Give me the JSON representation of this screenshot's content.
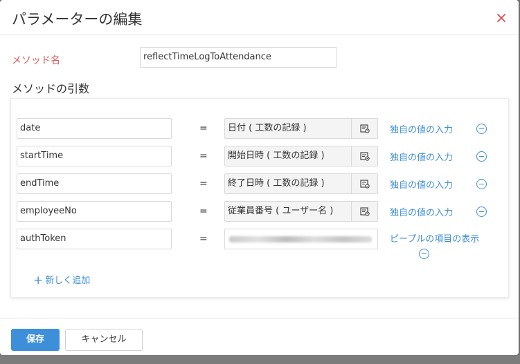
{
  "dialog": {
    "title": "パラメーターの編集",
    "close_icon": "close-x-icon",
    "close_color": "#e04a4a"
  },
  "method": {
    "label": "メソッド名",
    "value": "reflectTimeLogToAttendance"
  },
  "args": {
    "heading": "メソッドの引数",
    "equals": "=",
    "rows": [
      {
        "name": "date",
        "value": "日付 ( 工数の記録 )",
        "action": "独自の値の入力"
      },
      {
        "name": "startTime",
        "value": "開始日時 ( 工数の記録 )",
        "action": "独自の値の入力"
      },
      {
        "name": "endTime",
        "value": "終了日時 ( 工数の記録 )",
        "action": "独自の値の入力"
      },
      {
        "name": "employeeNo",
        "value": "従業員番号 ( ユーザー名 )",
        "action": "独自の値の入力"
      },
      {
        "name": "authToken",
        "value": "",
        "action": "ピープルの項目の表示"
      }
    ],
    "add_label": "新しく追加"
  },
  "footer": {
    "save_label": "保存",
    "cancel_label": "キャンセル"
  },
  "colors": {
    "accent": "#3d8fd9",
    "link": "#3f8fd8",
    "required_label": "#e05a5a"
  }
}
